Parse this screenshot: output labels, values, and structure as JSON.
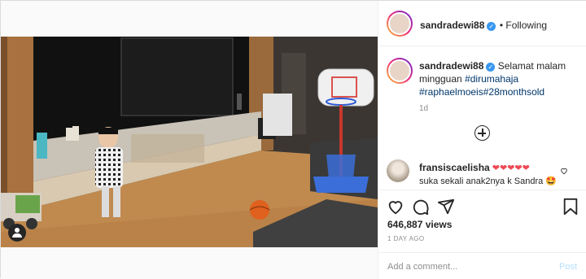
{
  "header": {
    "username": "sandradewi88",
    "follow_status": "• Following"
  },
  "caption": {
    "username": "sandradewi88",
    "text": "Selamat malam mingguan",
    "hashtags": [
      "#dirumahaja",
      "#raphaelmoeis",
      "#28monthsold"
    ],
    "time_ago": "1d"
  },
  "comments": [
    {
      "username": "fransiscaelisha",
      "text_line1": "❤❤❤❤❤",
      "text_line2": "suka sekali anak2nya k Sandra 🤩"
    }
  ],
  "stats": {
    "views": "646,887 views",
    "date": "1 DAY AGO"
  },
  "add_comment": {
    "placeholder": "Add a comment...",
    "post_label": "Post"
  },
  "icons": {
    "verified": "verified-badge-icon",
    "like": "heart-icon",
    "comment": "comment-bubble-icon",
    "share": "paper-plane-icon",
    "save": "bookmark-icon",
    "load_more": "plus-circle-icon",
    "comment_like": "small-heart-icon",
    "user_tag": "user-tag-icon"
  },
  "colors": {
    "link": "#00376b",
    "verified": "#3897f0",
    "post_disabled": "#b2dffc",
    "heart": "#ed4956"
  }
}
